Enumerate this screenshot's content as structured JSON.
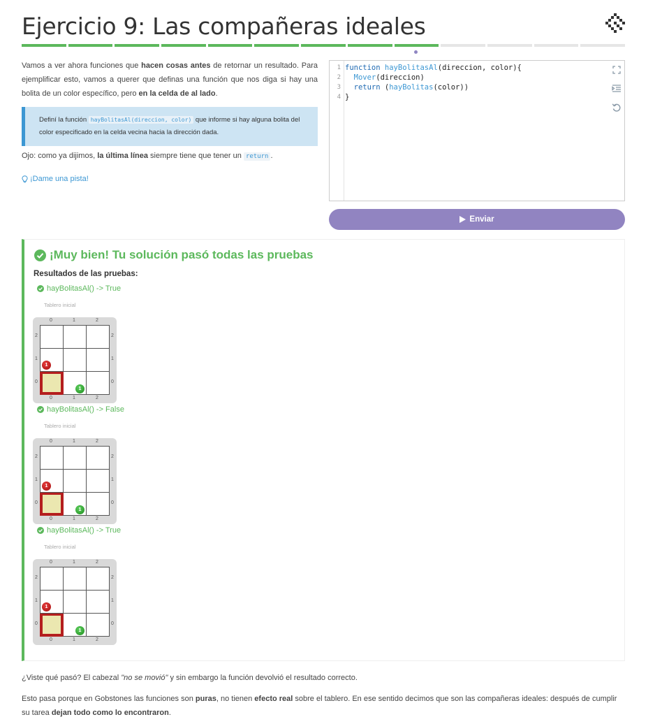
{
  "title": "Ejercicio 9: Las compañeras ideales",
  "logo_icon": "gobstones-diamond-logo-icon",
  "progress": {
    "total_segments": 13,
    "completed_segments": 9,
    "current_segment": 9
  },
  "description": {
    "intro_1": "Vamos a ver ahora funciones que ",
    "intro_bold_1": "hacen cosas antes",
    "intro_2": " de retornar un resultado. Para ejemplificar esto, vamos a querer que definas una función que nos diga si hay una bolita de un color específico, pero ",
    "intro_bold_2": "en la celda de al lado",
    "intro_3": "."
  },
  "callout": {
    "prefix": "Definí la función ",
    "code": "hayBolitasAl(direccion, color)",
    "suffix": " que informe si hay alguna bolita del color especificado en la celda vecina hacia la dirección dada."
  },
  "note": {
    "prefix": "Ojo: como ya dijimos, ",
    "bold": "la última línea",
    "middle": " siempre tiene que tener un ",
    "code": "return",
    "suffix": "."
  },
  "hint": {
    "label": "¡Dame una pista!",
    "icon": "lightbulb-icon"
  },
  "editor": {
    "lines": [
      {
        "num": "1",
        "parts": [
          {
            "t": "function ",
            "c": "kw"
          },
          {
            "t": "hayBolitasAl",
            "c": "fn"
          },
          {
            "t": "(direccion, color){",
            "c": "tx"
          }
        ]
      },
      {
        "num": "2",
        "parts": [
          {
            "t": "  Mover",
            "c": "fn"
          },
          {
            "t": "(direccion)",
            "c": "tx"
          }
        ]
      },
      {
        "num": "3",
        "parts": [
          {
            "t": "  return ",
            "c": "kw"
          },
          {
            "t": "(",
            "c": "tx"
          },
          {
            "t": "hayBolitas",
            "c": "fn"
          },
          {
            "t": "(color))",
            "c": "tx"
          }
        ]
      },
      {
        "num": "4",
        "parts": [
          {
            "t": "}",
            "c": "tx"
          }
        ]
      }
    ],
    "tools": [
      "fullscreen-icon",
      "indent-icon",
      "reset-icon"
    ]
  },
  "submit": {
    "label": "Enviar",
    "icon": "play-icon"
  },
  "result": {
    "title": "¡Muy bien! Tu solución pasó todas las pruebas",
    "subtitle": "Resultados de las pruebas:",
    "tests": [
      {
        "name": "hayBolitasAl() -> True",
        "board_label": "Tablero inicial"
      },
      {
        "name": "hayBolitasAl() -> False",
        "board_label": "Tablero inicial"
      },
      {
        "name": "hayBolitasAl() -> True",
        "board_label": "Tablero inicial"
      }
    ],
    "board": {
      "cols": [
        "0",
        "1",
        "2"
      ],
      "rows": [
        "2",
        "1",
        "0"
      ],
      "head": {
        "x": 0,
        "y": 0
      },
      "balls": [
        {
          "x": 0,
          "y": 1,
          "color": "red",
          "count": "1"
        },
        {
          "x": 1,
          "y": 0,
          "color": "green",
          "count": "1"
        }
      ]
    }
  },
  "footer": {
    "p1_prefix": "¿Viste qué pasó? El cabezal ",
    "p1_italic": "\"no se movió\"",
    "p1_suffix": " y sin embargo la función devolvió el resultado correcto.",
    "p2_a": "Esto pasa porque en Gobstones las funciones son ",
    "p2_b": "puras",
    "p2_c": ", no tienen ",
    "p2_d": "efecto real",
    "p2_e": " sobre el tablero. En ese sentido decimos que son las compañeras ideales: después de cumplir su tarea ",
    "p2_f": "dejan todo como lo encontraron",
    "p2_g": "."
  },
  "colors": {
    "success": "#5cb85c",
    "accent": "#3c97d3",
    "button": "#9184c1",
    "head_border": "#b41e1e"
  }
}
